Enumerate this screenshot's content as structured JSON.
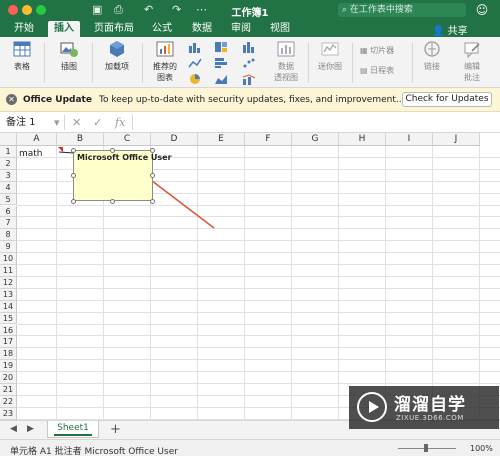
{
  "window": {
    "title": "工作簿1",
    "search_placeholder": "在工作表中搜索",
    "share_label": "共享"
  },
  "tabs": [
    "开始",
    "插入",
    "页面布局",
    "公式",
    "数据",
    "审阅",
    "视图"
  ],
  "ribbon": {
    "table": "表格",
    "illustrations": "插图",
    "addins": "加载项",
    "recommended_charts_1": "推荐的",
    "recommended_charts_2": "图表",
    "pivot_chart_1": "数据",
    "pivot_chart_2": "透视图",
    "sparklines": "迷你图",
    "slicer": "切片器",
    "timeline": "日程表",
    "link": "链接",
    "edit_comment_1": "编辑",
    "edit_comment_2": "批注"
  },
  "message_bar": {
    "title": "Office Update",
    "text": "To keep up-to-date with security updates, fixes, and improvement...",
    "button": "Check for Updates"
  },
  "formula_bar": {
    "name_box": "备注 1",
    "fx": "fx"
  },
  "grid": {
    "columns": [
      "A",
      "B",
      "C",
      "D",
      "E",
      "F",
      "G",
      "H",
      "I",
      "J"
    ],
    "rows": [
      "1",
      "2",
      "3",
      "4",
      "5",
      "6",
      "7",
      "8",
      "9",
      "10",
      "11",
      "12",
      "13",
      "14",
      "15",
      "16",
      "17",
      "18",
      "19",
      "20",
      "21",
      "22",
      "23"
    ],
    "cell_a1": "math",
    "comment_author": "Microsoft Office User"
  },
  "sheets": {
    "active": "Sheet1",
    "add": "+"
  },
  "status": {
    "text": "单元格 A1 批注者 Microsoft Office User",
    "zoom": "100%"
  },
  "watermark": {
    "title": "溜溜自学",
    "subtitle": "ZIXUE.3D66.COM"
  },
  "colors": {
    "excel_green": "#217346",
    "comment_fill": "#ffffcc",
    "arrow_red": "#e0553a",
    "message_bar": "#fcf5d6"
  }
}
